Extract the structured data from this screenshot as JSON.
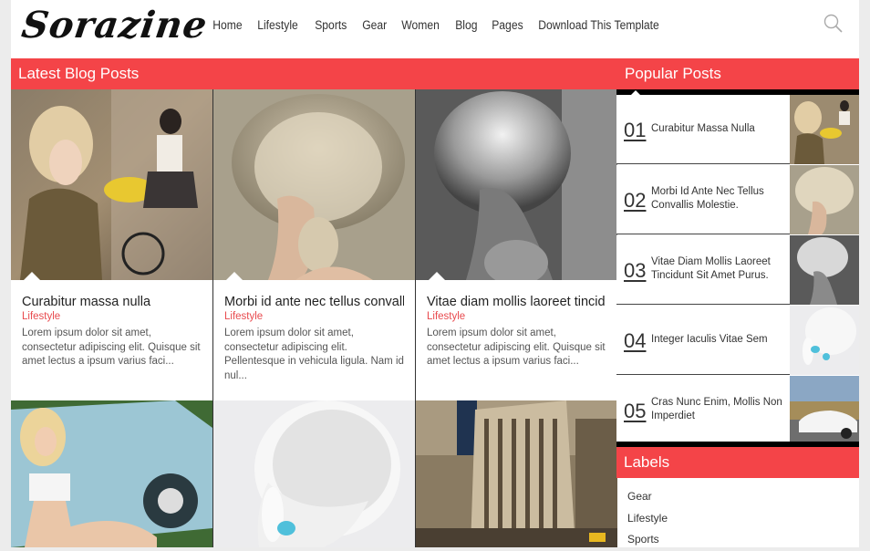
{
  "header": {
    "logo": "Sorazine",
    "nav": [
      "Home",
      "Lifestyle",
      "Sports",
      "Gear",
      "Women",
      "Blog",
      "Pages",
      "Download This Template"
    ],
    "search_icon": "search-icon"
  },
  "main": {
    "section_title": "Latest Blog Posts",
    "posts": [
      {
        "title": "Curabitur massa nulla",
        "category": "Lifestyle",
        "excerpt": "Lorem ipsum dolor sit amet, consectetur adipiscing elit. Quisque sit amet lectus a ipsum varius faci..."
      },
      {
        "title": "Morbi id ante nec tellus convalli…",
        "category": "Lifestyle",
        "excerpt": "Lorem ipsum dolor sit amet, consectetur adipiscing elit. Pellentesque in vehicula ligula. Nam id nul..."
      },
      {
        "title": "Vitae diam mollis laoreet tincid…",
        "category": "Lifestyle",
        "excerpt": "Lorem ipsum dolor sit amet, consectetur adipiscing elit. Quisque sit amet lectus a ipsum varius faci..."
      }
    ]
  },
  "sidebar": {
    "popular_title": "Popular Posts",
    "popular": [
      {
        "num": "01",
        "title": "Curabitur Massa Nulla"
      },
      {
        "num": "02",
        "title": "Morbi Id Ante Nec Tellus Convallis Molestie."
      },
      {
        "num": "03",
        "title": "Vitae Diam Mollis Laoreet Tincidunt Sit Amet Purus."
      },
      {
        "num": "04",
        "title": "Integer Iaculis Vitae Sem"
      },
      {
        "num": "05",
        "title": "Cras Nunc Enim, Mollis Non Imperdiet"
      }
    ],
    "labels_title": "Labels",
    "labels": [
      "Gear",
      "Lifestyle",
      "Sports"
    ]
  },
  "colors": {
    "accent": "#f44448",
    "category": "#e84a4e"
  }
}
